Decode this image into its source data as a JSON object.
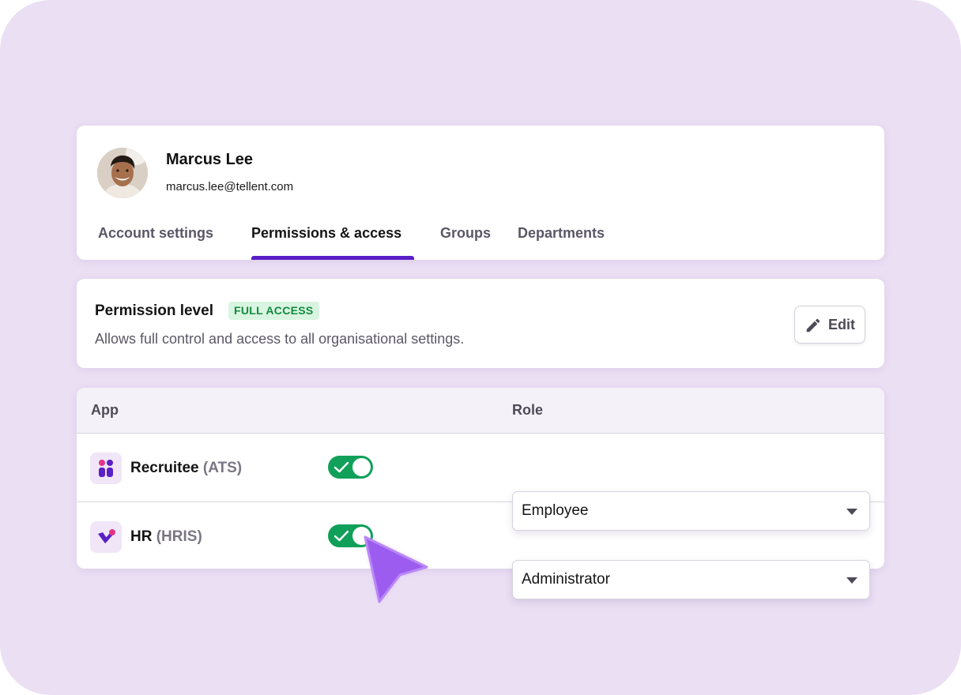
{
  "user": {
    "name": "Marcus Lee",
    "email": "marcus.lee@tellent.com"
  },
  "tabs": [
    {
      "label": "Account settings",
      "active": false
    },
    {
      "label": "Permissions & access",
      "active": true
    },
    {
      "label": "Groups",
      "active": false
    },
    {
      "label": "Departments",
      "active": false
    }
  ],
  "permission": {
    "title": "Permission level",
    "badge": "FULL ACCESS",
    "description": "Allows full control and access to all organisational settings.",
    "edit_label": "Edit"
  },
  "table": {
    "headers": {
      "app": "App",
      "role": "Role"
    },
    "rows": [
      {
        "name": "Recruitee",
        "tag": "(ATS)",
        "enabled": true,
        "role": "Employee",
        "icon": "recruitee-logo-icon"
      },
      {
        "name": "HR",
        "tag": "(HRIS)",
        "enabled": true,
        "role": "Administrator",
        "icon": "hr-logo-icon"
      }
    ]
  },
  "colors": {
    "background": "#ebdff4",
    "accent": "#5a1fc7",
    "toggle_on": "#10a05a",
    "badge_bg": "#d9f5e1",
    "badge_text": "#138a3f",
    "cursor": "#9d5cf0"
  }
}
